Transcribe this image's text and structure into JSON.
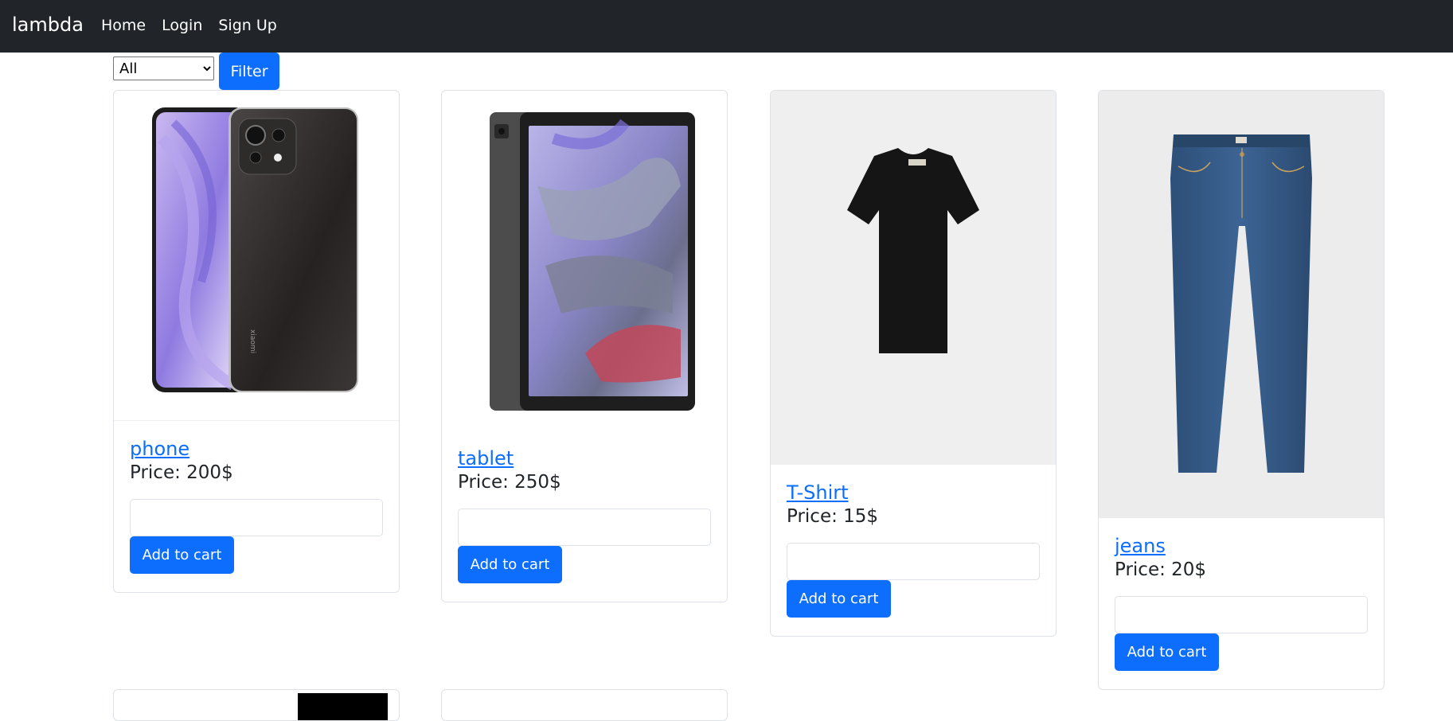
{
  "navbar": {
    "brand": "lambda",
    "links": [
      "Home",
      "Login",
      "Sign Up"
    ]
  },
  "filter": {
    "selected": "All",
    "button_label": "Filter"
  },
  "products": [
    {
      "name": "phone",
      "price": "Price: 200$",
      "button_label": "Add to cart"
    },
    {
      "name": "tablet",
      "price": "Price: 250$",
      "button_label": "Add to cart"
    },
    {
      "name": "T-Shirt",
      "price": "Price: 15$",
      "button_label": "Add to cart"
    },
    {
      "name": "jeans",
      "price": "Price: 20$",
      "button_label": "Add to cart"
    }
  ],
  "colors": {
    "navbar_bg": "#212529",
    "primary": "#0d6efd"
  }
}
